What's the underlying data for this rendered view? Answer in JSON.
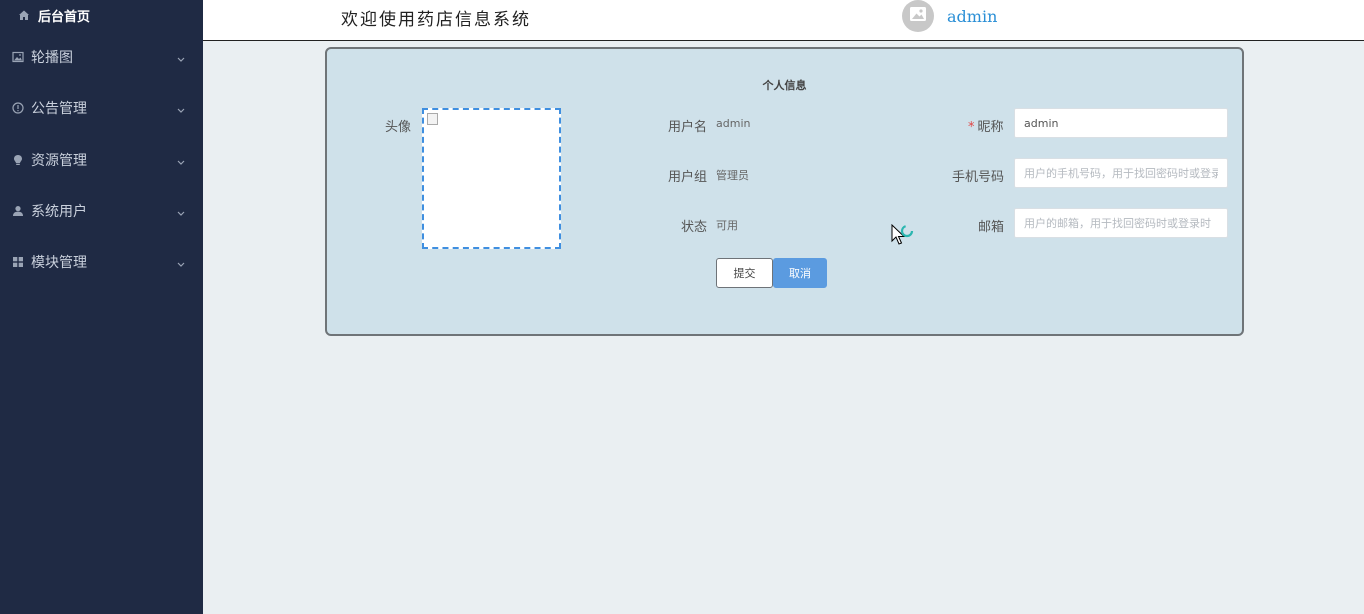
{
  "sidebar": {
    "items": [
      {
        "label": "后台首页",
        "icon": "home-icon"
      },
      {
        "label": "轮播图",
        "icon": "image-icon"
      },
      {
        "label": "公告管理",
        "icon": "info-circle-icon"
      },
      {
        "label": "资源管理",
        "icon": "bulb-icon"
      },
      {
        "label": "系统用户",
        "icon": "user-icon"
      },
      {
        "label": "模块管理",
        "icon": "grid-icon"
      }
    ]
  },
  "header": {
    "welcome": "欢迎使用药店信息系统",
    "user": "admin"
  },
  "profile": {
    "title": "个人信息",
    "avatar_label": "头像",
    "username_label": "用户名",
    "username_value": "admin",
    "group_label": "用户组",
    "group_value": "管理员",
    "status_label": "状态",
    "status_value": "可用",
    "nickname_required": "*",
    "nickname_label": "昵称",
    "nickname_value": "admin",
    "phone_label": "手机号码",
    "phone_placeholder": "用户的手机号码，用于找回密码时或登录时",
    "email_label": "邮箱",
    "email_placeholder": "用户的邮箱，用于找回密码时或登录时",
    "submit": "提交",
    "cancel": "取消"
  },
  "colors": {
    "sidebar_bg": "#1f2a44",
    "panel_bg": "#cfe1ea",
    "accent": "#5b9be0",
    "link": "#2a8fd6"
  }
}
